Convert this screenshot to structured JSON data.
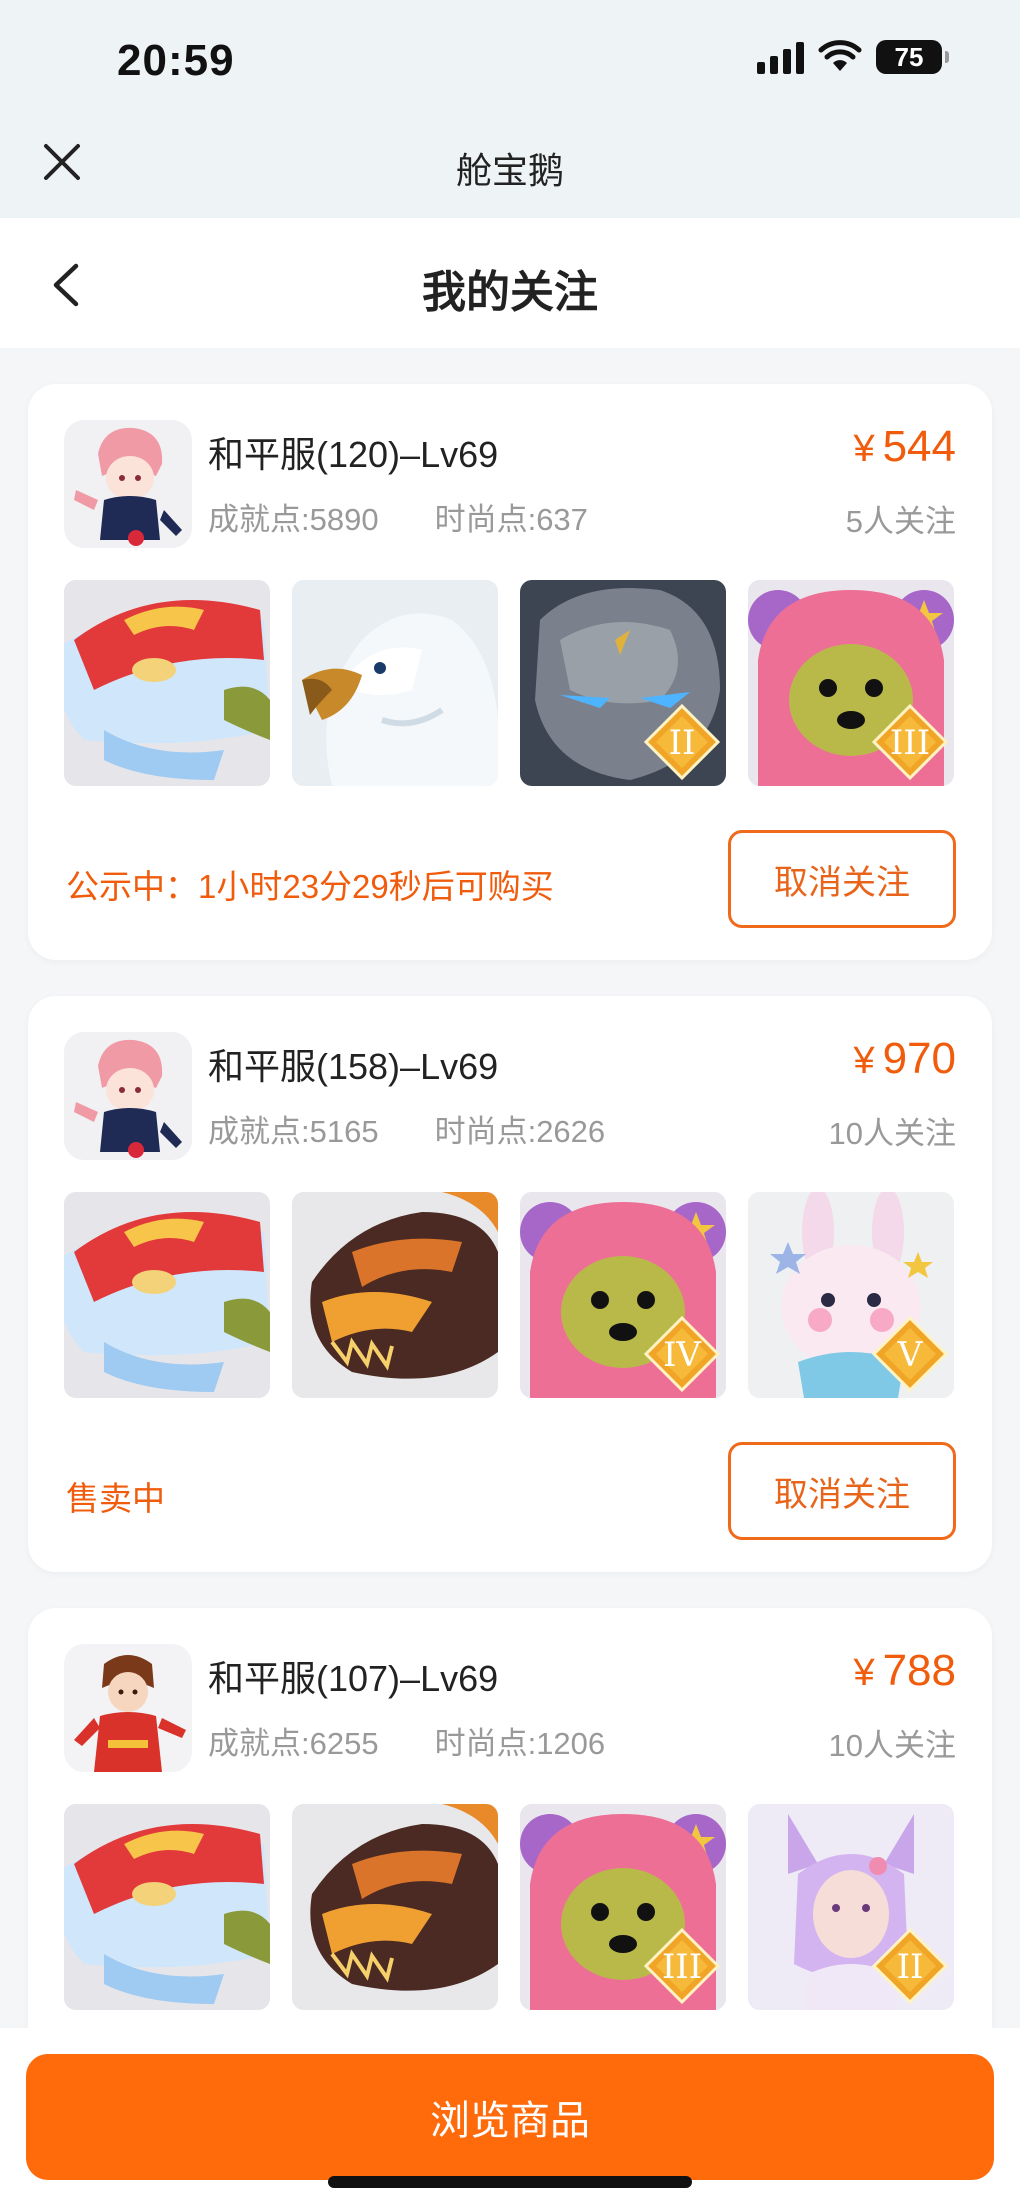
{
  "status_bar": {
    "time": "20:59",
    "battery": "75"
  },
  "webview": {
    "title": "舱宝鹅"
  },
  "header": {
    "title": "我的关注"
  },
  "colors": {
    "accent": "#ff6a0a",
    "price": "#f05c0c"
  },
  "cards": [
    {
      "server": "和平服(120)–Lv69",
      "achievement": "成就点:5890",
      "fashion": "时尚点:637",
      "currency": "¥",
      "price": "544",
      "followers": "5人关注",
      "status": "公示中：1小时23分29秒后可购买",
      "button": "取消关注",
      "thumbs": [
        {
          "icon": "fish-mount"
        },
        {
          "icon": "eagle-mount"
        },
        {
          "icon": "stone-golem",
          "tier": "II"
        },
        {
          "icon": "pink-bear",
          "tier": "III"
        }
      ]
    },
    {
      "server": "和平服(158)–Lv69",
      "achievement": "成就点:5165",
      "fashion": "时尚点:2626",
      "currency": "¥",
      "price": "970",
      "followers": "10人关注",
      "status": "售卖中",
      "button": "取消关注",
      "thumbs": [
        {
          "icon": "fish-mount"
        },
        {
          "icon": "dragon-mount"
        },
        {
          "icon": "pink-bear",
          "tier": "IV"
        },
        {
          "icon": "white-rabbit",
          "tier": "V"
        }
      ]
    },
    {
      "server": "和平服(107)–Lv69",
      "achievement": "成就点:6255",
      "fashion": "时尚点:1206",
      "currency": "¥",
      "price": "788",
      "followers": "10人关注",
      "status": "",
      "button": "",
      "thumbs": [
        {
          "icon": "fish-mount"
        },
        {
          "icon": "dragon-mount"
        },
        {
          "icon": "pink-bear",
          "tier": "III"
        },
        {
          "icon": "fox-girl",
          "tier": "II"
        }
      ]
    }
  ],
  "footer": {
    "browse_label": "浏览商品"
  }
}
